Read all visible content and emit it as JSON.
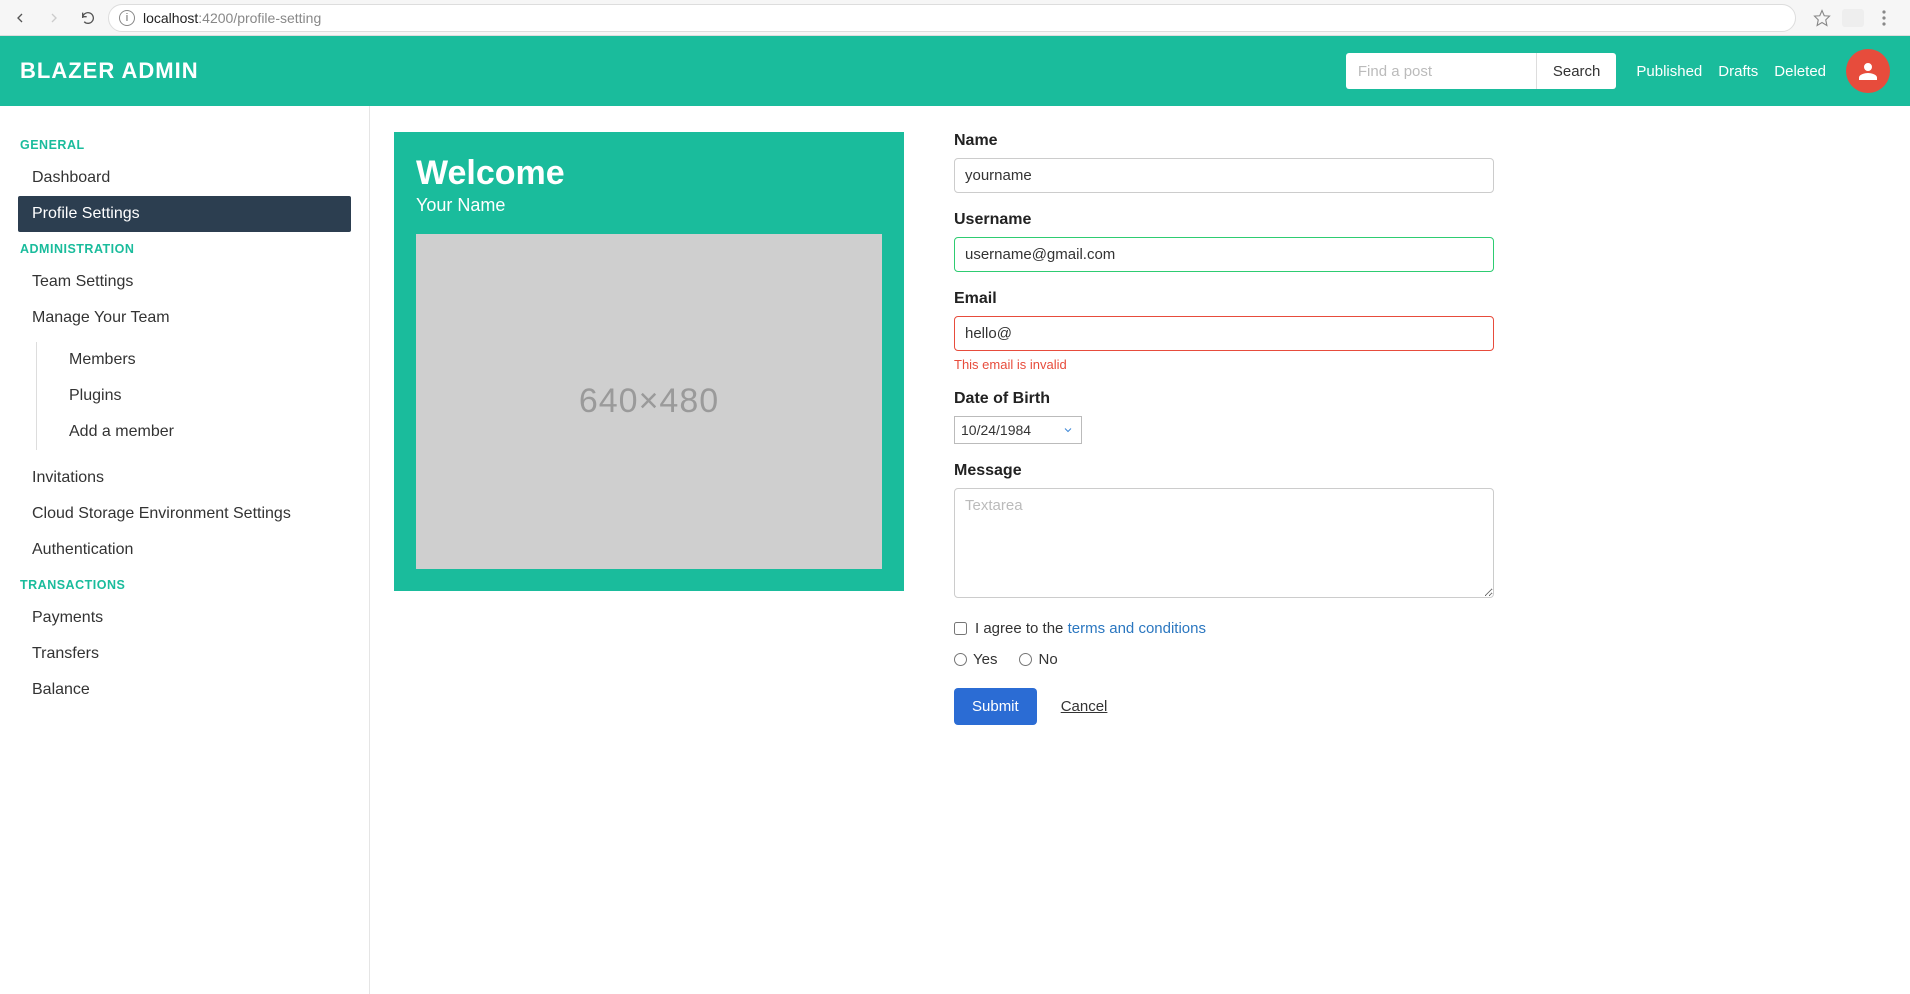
{
  "browser": {
    "url_host": "localhost",
    "url_port": ":4200",
    "url_path": "/profile-setting"
  },
  "header": {
    "brand": "BLAZER ADMIN",
    "search_placeholder": "Find a post",
    "search_button": "Search",
    "links": [
      "Published",
      "Drafts",
      "Deleted"
    ]
  },
  "sidebar": {
    "sections": [
      {
        "title": "GENERAL",
        "items": [
          {
            "label": "Dashboard",
            "active": false
          },
          {
            "label": "Profile Settings",
            "active": true
          }
        ]
      },
      {
        "title": "ADMINISTRATION",
        "items": [
          {
            "label": "Team Settings"
          },
          {
            "label": "Manage Your Team",
            "children": [
              {
                "label": "Members"
              },
              {
                "label": "Plugins"
              },
              {
                "label": "Add a member"
              }
            ]
          },
          {
            "label": "Invitations"
          },
          {
            "label": "Cloud Storage Environment Settings"
          },
          {
            "label": "Authentication"
          }
        ]
      },
      {
        "title": "TRANSACTIONS",
        "items": [
          {
            "label": "Payments"
          },
          {
            "label": "Transfers"
          },
          {
            "label": "Balance"
          }
        ]
      }
    ]
  },
  "welcome": {
    "title": "Welcome",
    "subtitle": "Your Name",
    "placeholder_text": "640×480"
  },
  "form": {
    "name": {
      "label": "Name",
      "value": "yourname"
    },
    "username": {
      "label": "Username",
      "value": "username@gmail.com",
      "state": "valid"
    },
    "email": {
      "label": "Email",
      "value": "hello@",
      "state": "invalid",
      "error": "This email is invalid"
    },
    "dob": {
      "label": "Date of Birth",
      "value": "10/24/1984"
    },
    "message": {
      "label": "Message",
      "placeholder": "Textarea",
      "value": ""
    },
    "agree": {
      "text_before": "I agree to the ",
      "link_text": "terms and conditions",
      "checked": false
    },
    "radio": {
      "yes": "Yes",
      "no": "No"
    },
    "submit": "Submit",
    "cancel": "Cancel"
  }
}
